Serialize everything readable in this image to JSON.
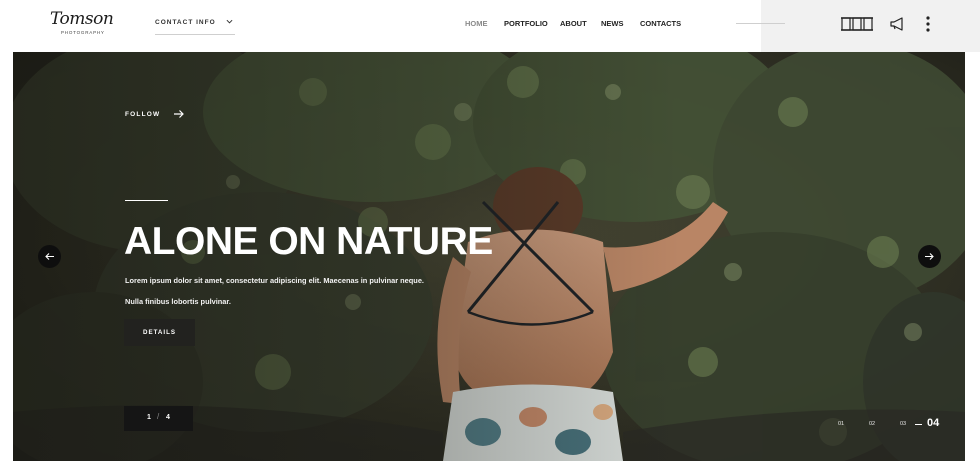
{
  "header": {
    "logo": {
      "name": "Tomson",
      "tagline": "PHOTOGRAPHY"
    },
    "contact_info_label": "CONTACT INFO",
    "nav": [
      {
        "label": "HOME",
        "active": true
      },
      {
        "label": "PORTFOLIO",
        "active": false
      },
      {
        "label": "ABOUT",
        "active": false
      },
      {
        "label": "NEWS",
        "active": false
      },
      {
        "label": "CONTACTS",
        "active": false
      }
    ],
    "icons": [
      "layout-icon",
      "megaphone-icon",
      "more-vertical-icon"
    ]
  },
  "hero": {
    "follow_label": "FOLLOW",
    "title": "ALONE ON NATURE",
    "text_lines": [
      "Lorem ipsum dolor sit amet, consectetur adipiscing elit. Maecenas in pulvinar neque.",
      "Nulla finibus lobortis pulvinar."
    ],
    "details_label": "DETAILS",
    "counter": {
      "current": "1",
      "separator": "/",
      "total": "4"
    },
    "pager": [
      "01",
      "02",
      "03",
      "04"
    ],
    "pager_active_index": 3,
    "prev_icon": "arrow-left-icon",
    "next_icon": "arrow-right-icon"
  },
  "colors": {
    "header_bg": "#ffffff",
    "header_panel_bg": "#f1f1f1",
    "nav_active": "#8a8a8a",
    "dark_button": "#22221f",
    "hero_text": "#ffffff"
  }
}
